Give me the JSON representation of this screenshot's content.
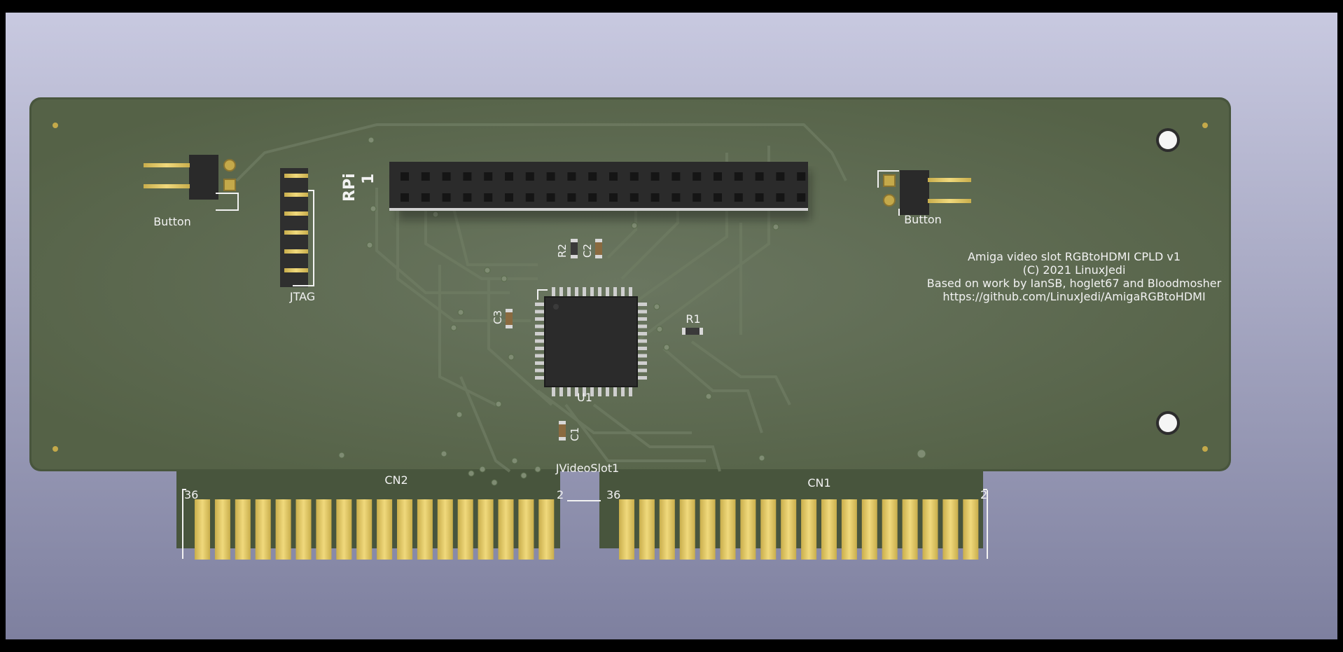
{
  "viewer": {
    "background_top": "#c8c9e0",
    "background_bottom": "#7e809f",
    "frame_color": "#000000"
  },
  "board": {
    "soldermask_color": "#5c6a4f",
    "trace_color": "#6d7b60",
    "silkscreen_color": "#f2f2f2",
    "gold_color": "#e0c86a",
    "notes": {
      "line1": "Amiga video slot RGBtoHDMI CPLD v1",
      "line2": "(C) 2021 LinuxJedi",
      "line3": "Based on work by IanSB, hoglet67 and Bloodmosher",
      "line4": "https://github.com/LinuxJedi/AmigaRGBtoHDMI"
    },
    "labels": {
      "button_left": "Button",
      "button_right": "Button",
      "jtag": "JTAG",
      "rpi": "RPi",
      "rpi_pin1": "1",
      "u1": "U1",
      "r1": "R1",
      "r2": "R2",
      "c1": "C1",
      "c2": "C2",
      "c3": "C3",
      "slot": "JVideoSlot1",
      "cn1": "CN1",
      "cn2": "CN2",
      "cn2_first": "36",
      "cn2_last": "2",
      "cn1_first": "36",
      "cn1_last": "2"
    },
    "edge_connector": {
      "fingers_per_bank": 18
    },
    "rpi_header": {
      "rows": 2,
      "columns": 20
    },
    "cpld": {
      "pins_per_side": 11
    }
  }
}
